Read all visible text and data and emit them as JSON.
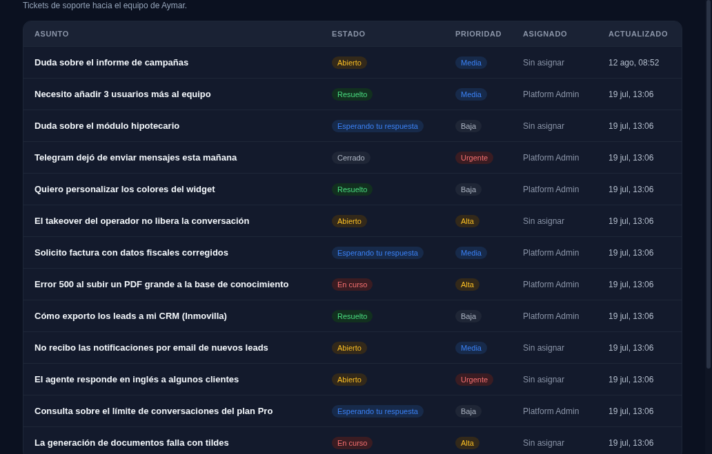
{
  "subtitle": "Tickets de soporte hacia el equipo de Aymar.",
  "table": {
    "columns": [
      "ASUNTO",
      "ESTADO",
      "PRIORIDAD",
      "ASIGNADO",
      "ACTUALIZADO"
    ],
    "rows": [
      {
        "subject": "Duda sobre el informe de campañas",
        "status": {
          "label": "Abierto",
          "kind": "amber"
        },
        "priority": {
          "label": "Media",
          "kind": "blue"
        },
        "assignee": "Sin asignar",
        "updated": "12 ago, 08:52"
      },
      {
        "subject": "Necesito añadir 3 usuarios más al equipo",
        "status": {
          "label": "Resuelto",
          "kind": "green"
        },
        "priority": {
          "label": "Media",
          "kind": "blue"
        },
        "assignee": "Platform Admin",
        "updated": "19 jul, 13:06"
      },
      {
        "subject": "Duda sobre el módulo hipotecario",
        "status": {
          "label": "Esperando tu respuesta",
          "kind": "blue"
        },
        "priority": {
          "label": "Baja",
          "kind": "gray"
        },
        "assignee": "Sin asignar",
        "updated": "19 jul, 13:06"
      },
      {
        "subject": "Telegram dejó de enviar mensajes esta mañana",
        "status": {
          "label": "Cerrado",
          "kind": "gray"
        },
        "priority": {
          "label": "Urgente",
          "kind": "red"
        },
        "assignee": "Platform Admin",
        "updated": "19 jul, 13:06"
      },
      {
        "subject": "Quiero personalizar los colores del widget",
        "status": {
          "label": "Resuelto",
          "kind": "green"
        },
        "priority": {
          "label": "Baja",
          "kind": "gray"
        },
        "assignee": "Platform Admin",
        "updated": "19 jul, 13:06"
      },
      {
        "subject": "El takeover del operador no libera la conversación",
        "status": {
          "label": "Abierto",
          "kind": "amber"
        },
        "priority": {
          "label": "Alta",
          "kind": "amber"
        },
        "assignee": "Sin asignar",
        "updated": "19 jul, 13:06"
      },
      {
        "subject": "Solicito factura con datos fiscales corregidos",
        "status": {
          "label": "Esperando tu respuesta",
          "kind": "blue"
        },
        "priority": {
          "label": "Media",
          "kind": "blue"
        },
        "assignee": "Platform Admin",
        "updated": "19 jul, 13:06"
      },
      {
        "subject": "Error 500 al subir un PDF grande a la base de conocimiento",
        "status": {
          "label": "En curso",
          "kind": "red"
        },
        "priority": {
          "label": "Alta",
          "kind": "amber"
        },
        "assignee": "Platform Admin",
        "updated": "19 jul, 13:06"
      },
      {
        "subject": "Cómo exporto los leads a mi CRM (Inmovilla)",
        "status": {
          "label": "Resuelto",
          "kind": "green"
        },
        "priority": {
          "label": "Baja",
          "kind": "gray"
        },
        "assignee": "Platform Admin",
        "updated": "19 jul, 13:06"
      },
      {
        "subject": "No recibo las notificaciones por email de nuevos leads",
        "status": {
          "label": "Abierto",
          "kind": "amber"
        },
        "priority": {
          "label": "Media",
          "kind": "blue"
        },
        "assignee": "Sin asignar",
        "updated": "19 jul, 13:06"
      },
      {
        "subject": "El agente responde en inglés a algunos clientes",
        "status": {
          "label": "Abierto",
          "kind": "amber"
        },
        "priority": {
          "label": "Urgente",
          "kind": "red"
        },
        "assignee": "Sin asignar",
        "updated": "19 jul, 13:06"
      },
      {
        "subject": "Consulta sobre el límite de conversaciones del plan Pro",
        "status": {
          "label": "Esperando tu respuesta",
          "kind": "blue"
        },
        "priority": {
          "label": "Baja",
          "kind": "gray"
        },
        "assignee": "Platform Admin",
        "updated": "19 jul, 13:06"
      },
      {
        "subject": "La generación de documentos falla con tildes",
        "status": {
          "label": "En curso",
          "kind": "red"
        },
        "priority": {
          "label": "Alta",
          "kind": "amber"
        },
        "assignee": "Sin asignar",
        "updated": "19 jul, 13:06"
      }
    ]
  }
}
